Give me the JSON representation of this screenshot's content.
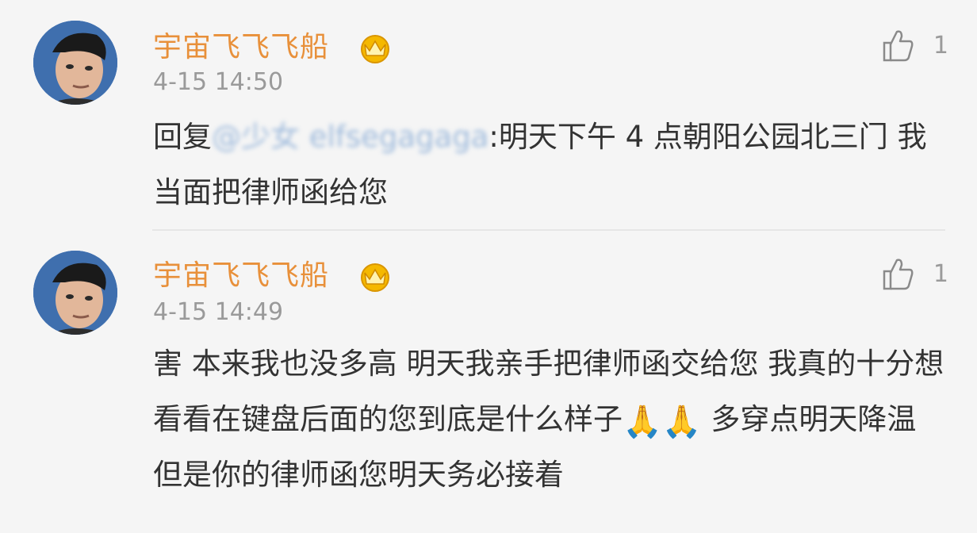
{
  "comments": [
    {
      "username": "宇宙飞飞飞船",
      "badge_icon": "vip-crown-icon",
      "time": "4-15 14:50",
      "like_icon": "thumbs-up-icon",
      "like_count": "1",
      "reply_prefix": "回复",
      "mention": "@少女 elfsegagaga",
      "text": ":明天下午 4 点朝阳公园北三门 我当面把律师函给您"
    },
    {
      "username": "宇宙飞飞飞船",
      "badge_icon": "vip-crown-icon",
      "time": "4-15 14:49",
      "like_icon": "thumbs-up-icon",
      "like_count": "1",
      "text_part1": "害 本来我也没多高 明天我亲手把律师函交给您 我真的十分想看看在键盘后面的您到底是什么样子",
      "emoji1": "🙏",
      "emoji2": "🙏",
      "text_part2": " 多穿点明天降温 但是你的律师函您明天务必接着"
    }
  ],
  "colors": {
    "username": "#e8903a",
    "time": "#9a9a9a",
    "body": "#333333",
    "background": "#f5f5f5"
  }
}
